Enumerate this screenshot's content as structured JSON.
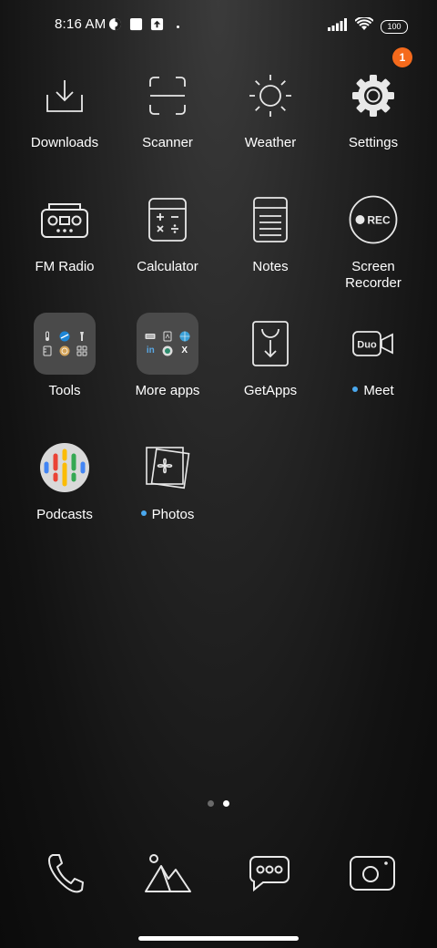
{
  "status_bar": {
    "time": "8:16 AM",
    "battery": "100"
  },
  "apps": [
    {
      "id": "downloads",
      "label": "Downloads"
    },
    {
      "id": "scanner",
      "label": "Scanner"
    },
    {
      "id": "weather",
      "label": "Weather"
    },
    {
      "id": "settings",
      "label": "Settings",
      "badge": "1"
    },
    {
      "id": "fm-radio",
      "label": "FM Radio"
    },
    {
      "id": "calculator",
      "label": "Calculator"
    },
    {
      "id": "notes",
      "label": "Notes"
    },
    {
      "id": "screen-recorder",
      "label": "Screen Recorder",
      "icon_text": "REC"
    },
    {
      "id": "tools",
      "label": "Tools"
    },
    {
      "id": "more-apps",
      "label": "More apps"
    },
    {
      "id": "getapps",
      "label": "GetApps"
    },
    {
      "id": "meet",
      "label": "Meet",
      "icon_text": "Duo"
    },
    {
      "id": "podcasts",
      "label": "Podcasts"
    },
    {
      "id": "photos",
      "label": "Photos"
    }
  ],
  "folders": {
    "tools_icons": [
      "thermometer-icon",
      "compass-icon",
      "flashlight-icon",
      "ruler-icon",
      "coin-icon",
      "grid-icon"
    ],
    "more_apps_icons": [
      "keyboard-icon",
      "notepad-icon",
      "globe-icon",
      "linkedin-icon",
      "chat-icon",
      "x-icon"
    ],
    "more_apps_text": [
      "in",
      "X"
    ]
  },
  "colors": {
    "badge": "#f56a1c",
    "new_dot": "#4aa8ee",
    "folder_bg": "#4a4a4a"
  },
  "dock": [
    "phone-icon",
    "gallery-icon",
    "messages-icon",
    "camera-icon"
  ]
}
